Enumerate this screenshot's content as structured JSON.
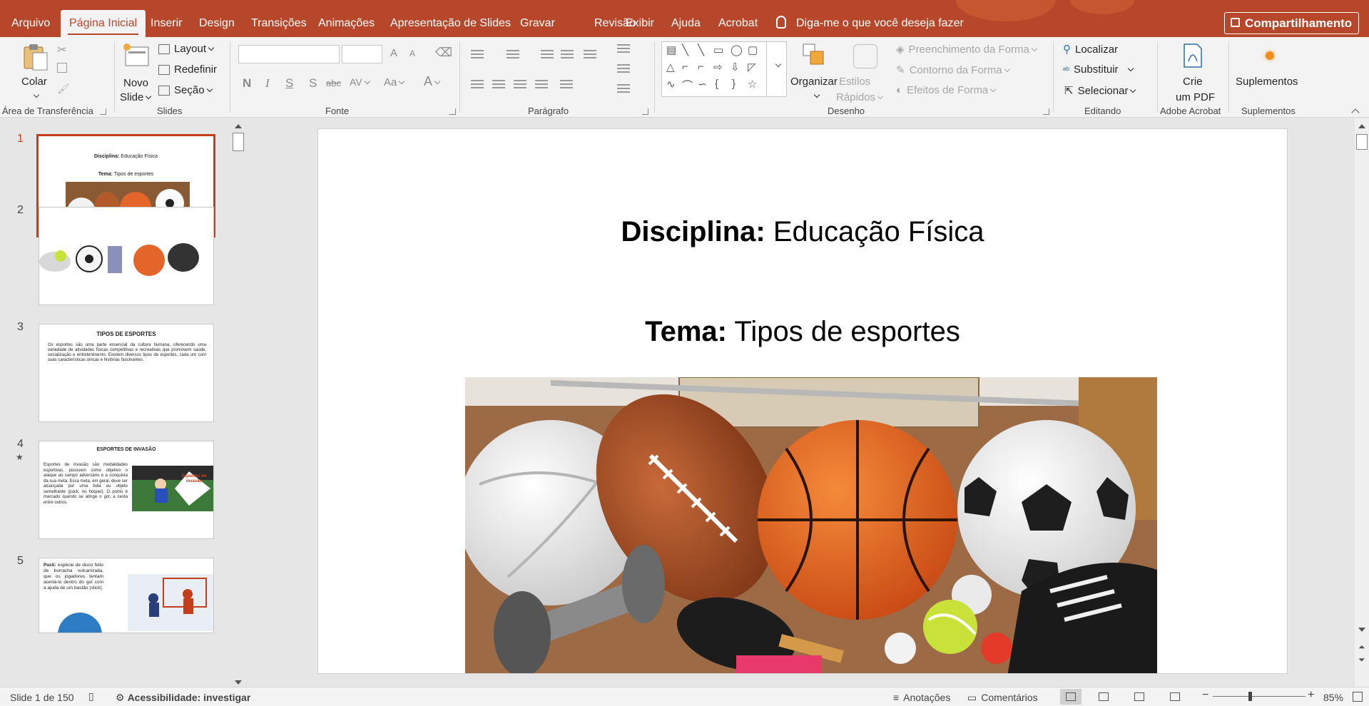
{
  "colors": {
    "accent": "#b7472a",
    "selection": "#c43e1c"
  },
  "tabs": [
    "Arquivo",
    "Página Inicial",
    "Inserir",
    "Design",
    "Transições",
    "Animações",
    "Apresentação de Slides",
    "Gravar",
    "Revisão",
    "Exibir",
    "Ajuda",
    "Acrobat"
  ],
  "active_tab": "Página Inicial",
  "tell_me": "Diga-me o que você deseja fazer",
  "share_label": "Compartilhamento",
  "ribbon": {
    "clipboard": {
      "paste": "Colar",
      "group": "Área de Transferência"
    },
    "slides": {
      "new_slide_1": "Novo",
      "new_slide_2": "Slide",
      "layout": "Layout",
      "reset": "Redefinir",
      "section": "Seção",
      "group": "Slides"
    },
    "font": {
      "group": "Fonte",
      "bold": "N",
      "italic": "I",
      "underline": "S",
      "shadow": "S",
      "strike": "abc",
      "spacing": "AV",
      "case": "Aa",
      "color": "A",
      "grow": "A",
      "shrink": "A"
    },
    "paragraph": {
      "group": "Parágrafo"
    },
    "drawing": {
      "arrange": "Organizar",
      "quick_styles_1": "Estilos",
      "quick_styles_2": "Rápidos",
      "fill": "Preenchimento da Forma",
      "outline": "Contorno da Forma",
      "effects": "Efeitos de Forma",
      "group": "Desenho"
    },
    "editing": {
      "find": "Localizar",
      "replace": "Substituir",
      "select": "Selecionar",
      "group": "Editando"
    },
    "acrobat": {
      "create_1": "Crie",
      "create_2": "um PDF",
      "group": "Adobe Acrobat"
    },
    "addins": {
      "label": "Suplementos",
      "group": "Suplementos"
    }
  },
  "thumbnails": [
    {
      "number": "1",
      "line1_bold": "Disciplina:",
      "line1": " Educação Física",
      "line2_bold": "Tema:",
      "line2": " Tipos de esportes"
    },
    {
      "number": "2"
    },
    {
      "number": "3",
      "title": "TIPOS DE ESPORTES",
      "body": "Os esportes são uma parte essencial da cultura humana, oferecendo uma variedade de atividades físicas competitivas e recreativas que promovem saúde, socialização e entretenimento. Existem diversos tipos de esportes, cada um com suas características únicas e histórias fascinantes."
    },
    {
      "number": "4",
      "star": "★",
      "title": "ESPORTES DE INVASÃO",
      "body": "Esportes de invasão são modalidades esportivas, possuem como objetivo o ataque ao campo adversário e a conquista da sua meta. Essa meta, em geral, deve ser alcançada por uma bola ou objeto semelhante (puck, no hóquei). O ponto é marcado quando se atinge o gol, a cesta entre outros.",
      "badge": "Esportes de invasão"
    },
    {
      "number": "5",
      "body_bold": "Puck:",
      "body": " espécie de disco feito de borracha vulcanizada, que os jogadores tentam acertá-lo dentro do gol com a ajuda de um bastão (stick)."
    }
  ],
  "slide": {
    "line1_bold": "Disciplina:",
    "line1": " Educação Física",
    "line2_bold": "Tema:",
    "line2": " Tipos de esportes"
  },
  "status": {
    "slide_count": "Slide 1 de 150",
    "accessibility": "Acessibilidade: investigar",
    "notes": "Anotações",
    "comments": "Comentários",
    "zoom": "85%"
  }
}
